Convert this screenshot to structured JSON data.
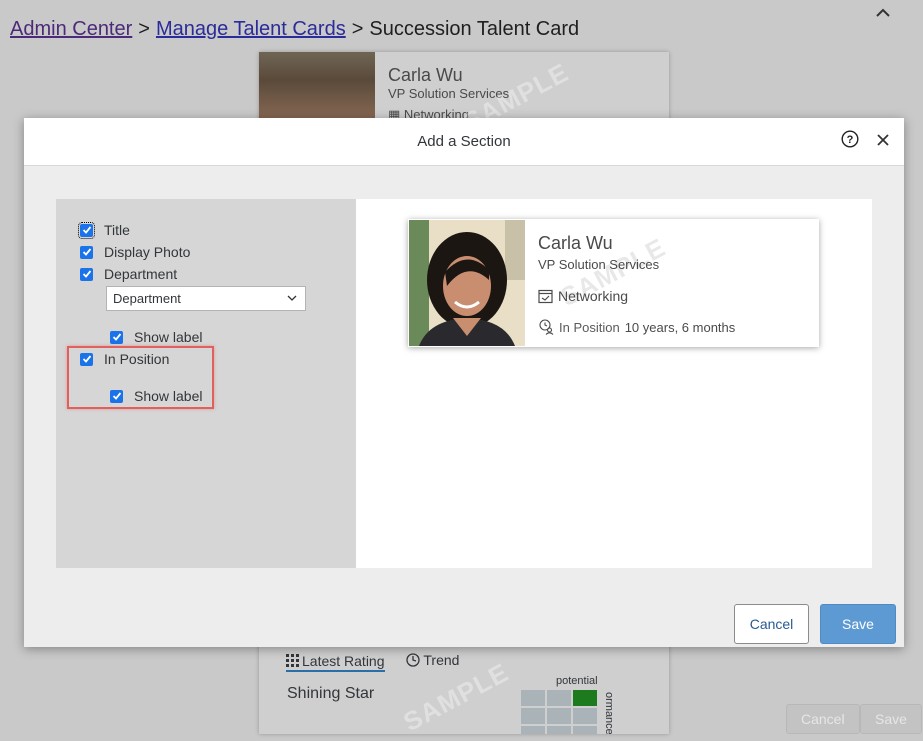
{
  "breadcrumb": {
    "items": [
      "Admin Center",
      "Manage Talent Cards"
    ],
    "current": "Succession Talent Card",
    "separator": ">"
  },
  "background_card": {
    "name": "Carla Wu",
    "title": "VP Solution Services",
    "department": "Networking",
    "watermark": "SAMPLE",
    "tabs": [
      "Latest Rating",
      "Trend"
    ],
    "rating_label": "Shining Star",
    "grid_top_label": "potential",
    "grid_side_label": "ormance"
  },
  "page_buttons": {
    "cancel": "Cancel",
    "save": "Save"
  },
  "modal": {
    "title": "Add a Section",
    "options": {
      "title": "Title",
      "display_photo": "Display Photo",
      "department": "Department",
      "department_select": "Department",
      "show_label_department": "Show label",
      "in_position": "In Position",
      "show_label_in_position": "Show label"
    },
    "preview": {
      "name": "Carla Wu",
      "title": "VP Solution Services",
      "watermark": "SAMPLE",
      "department": "Networking",
      "in_position_label": "In Position",
      "in_position_value": "10 years, 6 months"
    },
    "buttons": {
      "cancel": "Cancel",
      "save": "Save"
    }
  },
  "colors": {
    "checkbox": "#1a73e8",
    "save_button": "#5d9ad3",
    "highlight": "#e0605e",
    "rating_highlight": "#1d7a1d"
  }
}
